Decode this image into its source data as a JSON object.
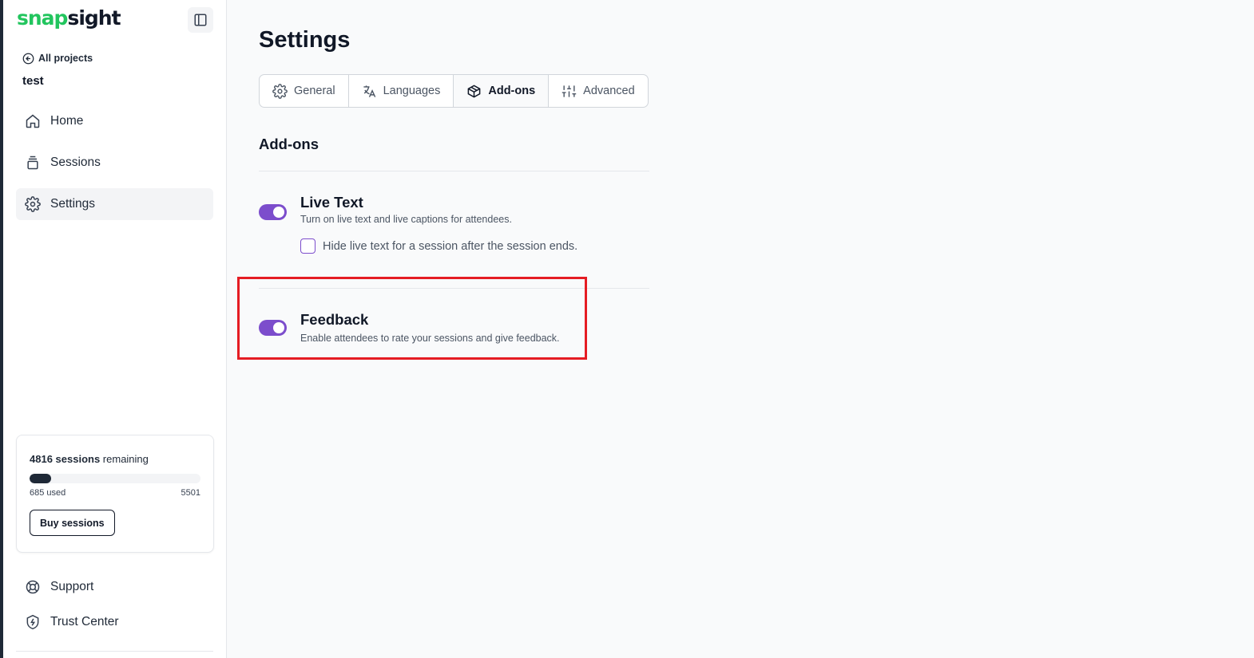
{
  "brand": {
    "logo_part1": "snap",
    "logo_part2": "sight",
    "accent_color": "#22c55e"
  },
  "sidebar": {
    "back_label": "All projects",
    "project_name": "test",
    "nav": [
      {
        "label": "Home",
        "icon": "home-icon"
      },
      {
        "label": "Sessions",
        "icon": "sessions-icon"
      },
      {
        "label": "Settings",
        "icon": "gear-icon",
        "active": true
      }
    ],
    "usage": {
      "remaining_count": "4816 sessions",
      "remaining_suffix": " remaining",
      "used_label": "685 used",
      "total_label": "5501",
      "used_fraction": 0.1245
    },
    "buy_label": "Buy sessions",
    "footer": [
      {
        "label": "Support",
        "icon": "lifebuoy-icon"
      },
      {
        "label": "Trust Center",
        "icon": "shield-icon"
      }
    ]
  },
  "main": {
    "title": "Settings",
    "tabs": [
      {
        "label": "General",
        "icon": "gear-icon"
      },
      {
        "label": "Languages",
        "icon": "translate-icon"
      },
      {
        "label": "Add-ons",
        "icon": "package-icon",
        "active": true
      },
      {
        "label": "Advanced",
        "icon": "sliders-icon"
      }
    ],
    "section_title": "Add-ons",
    "addons": [
      {
        "title": "Live Text",
        "description": "Turn on live text and live captions for attendees.",
        "enabled": true,
        "option_label": "Hide live text for a session after the session ends.",
        "option_checked": false
      },
      {
        "title": "Feedback",
        "description": "Enable attendees to rate your sessions and give feedback.",
        "enabled": true
      }
    ],
    "toggle_color": "#7c4dcc",
    "highlight_color": "#e51c23"
  }
}
